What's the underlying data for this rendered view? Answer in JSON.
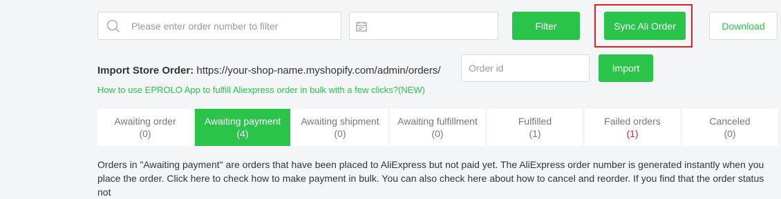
{
  "search": {
    "placeholder": "Please enter order number to filter",
    "value": ""
  },
  "toolbar": {
    "filter_label": "Filter",
    "sync_label": "Sync Ali Order",
    "download_label": "Download"
  },
  "import": {
    "label": "Import Store Order:",
    "url": "https://your-shop-name.myshopify.com/admin/orders/",
    "order_id_placeholder": "Order id",
    "import_label": "Import"
  },
  "help_link": "How to use EPROLO App to fulfill Aliexpress order in bulk with a few clicks?(NEW)",
  "tabs": [
    {
      "label": "Awaiting order",
      "count": "(0)"
    },
    {
      "label": "Awaiting payment",
      "count": "(4)"
    },
    {
      "label": "Awaiting shipment",
      "count": "(0)"
    },
    {
      "label": "Awaiting fulfillment",
      "count": "(0)"
    },
    {
      "label": "Fulfilled",
      "count": "(1)"
    },
    {
      "label": "Failed orders",
      "count": "(1)"
    },
    {
      "label": "Canceled",
      "count": "(0)"
    }
  ],
  "active_tab": "Awaiting payment",
  "description": "Orders in \"Awaiting payment\" are orders that have been placed to AliExpress but not paid yet. The AliExpress order number is generated instantly when you place the order. Click here to check how to make payment in bulk. You can also check here about how to cancel and reorder. If you find that the order status not",
  "colors": {
    "accent": "#2bc44a",
    "highlight": "#e02020",
    "error_count": "#e02020"
  },
  "icons": {
    "search": "search-icon",
    "date": "calendar-icon"
  }
}
